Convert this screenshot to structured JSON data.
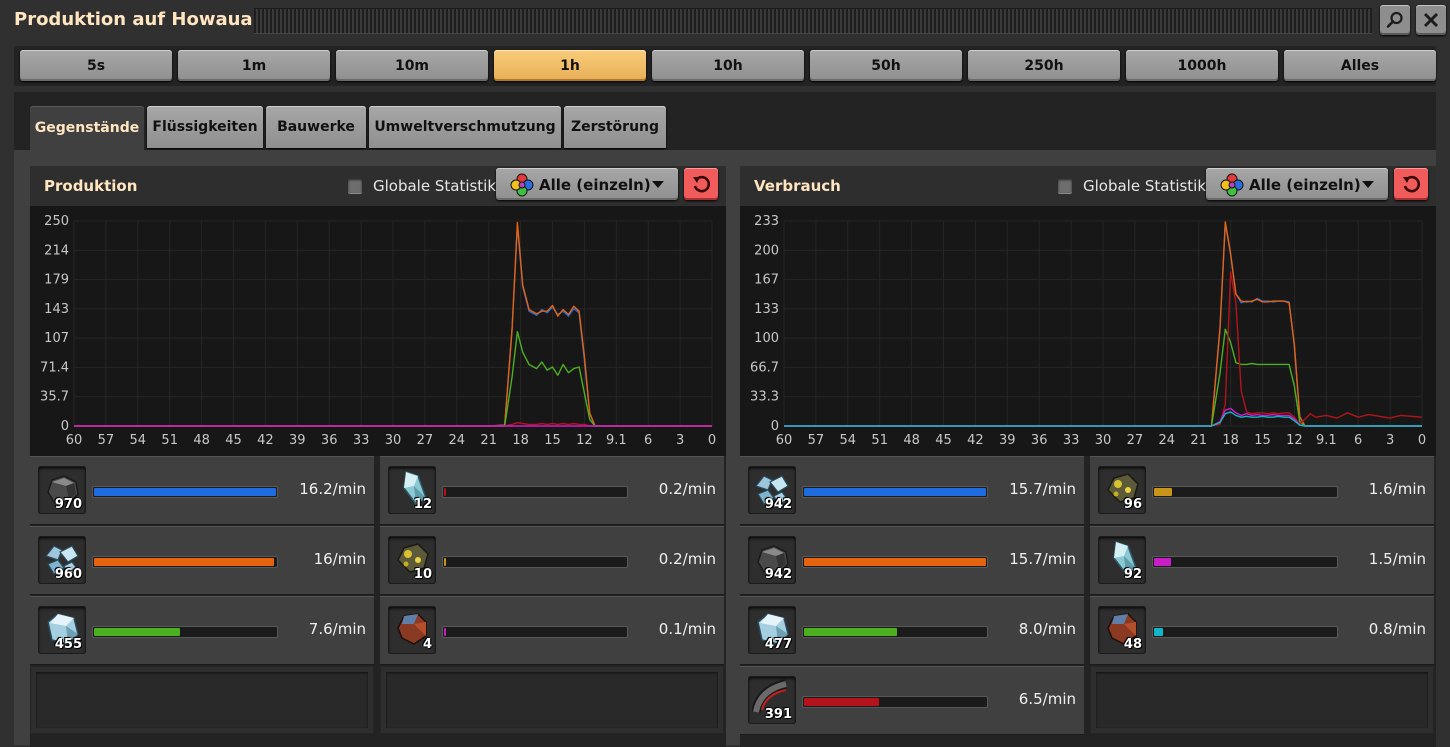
{
  "window": {
    "title": "Produktion auf Howaua"
  },
  "time_buttons": [
    {
      "label": "5s",
      "active": false
    },
    {
      "label": "1m",
      "active": false
    },
    {
      "label": "10m",
      "active": false
    },
    {
      "label": "1h",
      "active": true
    },
    {
      "label": "10h",
      "active": false
    },
    {
      "label": "50h",
      "active": false
    },
    {
      "label": "250h",
      "active": false
    },
    {
      "label": "1000h",
      "active": false
    },
    {
      "label": "Alles",
      "active": false
    }
  ],
  "tabs": [
    {
      "label": "Gegenstände",
      "active": true
    },
    {
      "label": "Flüssigkeiten",
      "active": false
    },
    {
      "label": "Bauwerke",
      "active": false
    },
    {
      "label": "Umweltverschmutzung",
      "active": false
    },
    {
      "label": "Zerstörung",
      "active": false
    }
  ],
  "colors": {
    "blue": "#1f6ce0",
    "orange": "#e5620f",
    "green": "#4caf1f",
    "red": "#b3141b",
    "yellow": "#c8951a",
    "magenta": "#c81ec8",
    "cyan": "#13b5c8"
  },
  "panels": [
    {
      "title": "Produktion",
      "global_label": "Globale Statistik",
      "dropdown_label": "Alle (einzeln)",
      "rows": [
        {
          "icon": "stone-icon",
          "count": "970",
          "rate": "16.2/min",
          "fill": 1.0,
          "color": "#1f6ce0"
        },
        {
          "icon": "ice-icon",
          "count": "12",
          "rate": "0.2/min",
          "fill": 0.012,
          "color": "#b3141b"
        },
        {
          "icon": "calcite-icon",
          "count": "960",
          "rate": "16/min",
          "fill": 0.99,
          "color": "#e5620f"
        },
        {
          "icon": "sulfur-ore-icon",
          "count": "10",
          "rate": "0.2/min",
          "fill": 0.01,
          "color": "#c8951a"
        },
        {
          "icon": "crystal-ore-icon",
          "count": "455",
          "rate": "7.6/min",
          "fill": 0.47,
          "color": "#4caf1f"
        },
        {
          "icon": "iron-ore-icon",
          "count": "4",
          "rate": "0.1/min",
          "fill": 0.005,
          "color": "#c81ec8"
        }
      ]
    },
    {
      "title": "Verbrauch",
      "global_label": "Globale Statistik",
      "dropdown_label": "Alle (einzeln)",
      "rows": [
        {
          "icon": "calcite-icon",
          "count": "942",
          "rate": "15.7/min",
          "fill": 1.0,
          "color": "#1f6ce0"
        },
        {
          "icon": "sulfur-ore-icon",
          "count": "96",
          "rate": "1.6/min",
          "fill": 0.1,
          "color": "#c8951a"
        },
        {
          "icon": "stone-icon",
          "count": "942",
          "rate": "15.7/min",
          "fill": 1.0,
          "color": "#e5620f"
        },
        {
          "icon": "ice-icon",
          "count": "92",
          "rate": "1.5/min",
          "fill": 0.096,
          "color": "#c81ec8"
        },
        {
          "icon": "crystal-ore-icon",
          "count": "477",
          "rate": "8.0/min",
          "fill": 0.51,
          "color": "#4caf1f"
        },
        {
          "icon": "iron-ore-icon",
          "count": "48",
          "rate": "0.8/min",
          "fill": 0.05,
          "color": "#13b5c8"
        },
        {
          "icon": "rail-icon",
          "count": "391",
          "rate": "6.5/min",
          "fill": 0.41,
          "color": "#b3141b"
        }
      ]
    }
  ],
  "chart_data": [
    {
      "type": "line",
      "title": "Produktion",
      "x_ticks": [
        "60",
        "57",
        "54",
        "51",
        "48",
        "45",
        "42",
        "39",
        "36",
        "33",
        "30",
        "27",
        "24",
        "21",
        "18",
        "15",
        "12",
        "9.1",
        "6",
        "3",
        "0"
      ],
      "y_ticks": [
        "0",
        "35.7",
        "71.4",
        "107",
        "143",
        "179",
        "214",
        "250"
      ],
      "ylim": [
        0,
        250
      ],
      "x": [
        60,
        21,
        19.5,
        18.8,
        18.3,
        17.8,
        17.2,
        16.5,
        16,
        15.5,
        15,
        14.5,
        14,
        13.5,
        13,
        12.5,
        12,
        11.5,
        11,
        10.5,
        10,
        9.5,
        0
      ],
      "series": [
        {
          "color": "#1f6ce0",
          "values": [
            0,
            0,
            1,
            120,
            245,
            170,
            140,
            135,
            142,
            138,
            145,
            136,
            140,
            134,
            143,
            138,
            80,
            15,
            0,
            0,
            0,
            0,
            0
          ]
        },
        {
          "color": "#e5620f",
          "values": [
            0,
            0,
            1,
            118,
            248,
            172,
            142,
            137,
            140,
            140,
            147,
            134,
            142,
            136,
            146,
            140,
            85,
            16,
            0,
            0,
            0,
            0,
            0
          ]
        },
        {
          "color": "#4caf1f",
          "values": [
            0,
            0,
            0,
            60,
            115,
            90,
            75,
            70,
            78,
            68,
            72,
            62,
            75,
            65,
            70,
            72,
            40,
            8,
            0,
            0,
            0,
            0,
            0
          ]
        },
        {
          "color": "#b3141b",
          "values": [
            0,
            0,
            0,
            2,
            4,
            3,
            2,
            2,
            3,
            2,
            3,
            2,
            3,
            2,
            3,
            2,
            2,
            0,
            0,
            0,
            0,
            0,
            0
          ]
        },
        {
          "color": "#c81ec8",
          "values": [
            0,
            0,
            0,
            0,
            0,
            0,
            0,
            0,
            0,
            0,
            0,
            0,
            0,
            0,
            0,
            0,
            0,
            0,
            0,
            0,
            0,
            0,
            0
          ]
        }
      ]
    },
    {
      "type": "line",
      "title": "Verbrauch",
      "x_ticks": [
        "60",
        "57",
        "54",
        "51",
        "48",
        "45",
        "42",
        "39",
        "36",
        "33",
        "30",
        "27",
        "24",
        "21",
        "18",
        "15",
        "12",
        "9.1",
        "6",
        "3",
        "0"
      ],
      "y_ticks": [
        "0",
        "33.3",
        "66.7",
        "100",
        "133",
        "167",
        "200",
        "233"
      ],
      "ylim": [
        0,
        233
      ],
      "x": [
        60,
        21,
        19.8,
        19,
        18.5,
        18,
        17.5,
        17,
        16.5,
        16,
        15.5,
        15,
        14.5,
        14,
        13.5,
        13,
        12.5,
        12,
        11.5,
        11,
        10.5,
        10,
        9,
        8,
        7,
        6,
        5,
        4,
        3,
        2,
        1,
        0
      ],
      "series": [
        {
          "color": "#1f6ce0",
          "values": [
            0,
            0,
            0,
            110,
            230,
            195,
            150,
            140,
            142,
            141,
            145,
            142,
            142,
            141,
            142,
            142,
            141,
            90,
            10,
            0,
            0,
            0,
            0,
            0,
            0,
            0,
            0,
            0,
            0,
            0,
            0,
            0
          ]
        },
        {
          "color": "#e5620f",
          "values": [
            0,
            0,
            0,
            112,
            232,
            196,
            150,
            142,
            141,
            142,
            144,
            141,
            141,
            142,
            142,
            142,
            140,
            92,
            11,
            0,
            0,
            0,
            0,
            0,
            0,
            0,
            0,
            0,
            0,
            0,
            0,
            0
          ]
        },
        {
          "color": "#4caf1f",
          "values": [
            0,
            0,
            0,
            60,
            110,
            95,
            72,
            70,
            70,
            71,
            70,
            70,
            70,
            70,
            70,
            70,
            70,
            45,
            5,
            0,
            0,
            0,
            0,
            0,
            0,
            0,
            0,
            0,
            0,
            0,
            0,
            0
          ]
        },
        {
          "color": "#b3141b",
          "values": [
            0,
            0,
            0,
            2,
            25,
            175,
            140,
            40,
            16,
            14,
            15,
            15,
            14,
            15,
            14,
            15,
            15,
            10,
            2,
            8,
            14,
            10,
            12,
            9,
            15,
            10,
            13,
            11,
            9,
            12,
            11,
            10
          ]
        },
        {
          "color": "#c81ec8",
          "values": [
            0,
            0,
            0,
            5,
            18,
            20,
            15,
            12,
            14,
            12,
            13,
            12,
            12,
            13,
            12,
            12,
            12,
            8,
            1,
            0,
            0,
            0,
            0,
            0,
            0,
            0,
            0,
            0,
            0,
            0,
            0,
            0
          ]
        },
        {
          "color": "#13b5c8",
          "values": [
            0,
            0,
            0,
            4,
            14,
            16,
            12,
            10,
            11,
            10,
            10,
            11,
            10,
            10,
            11,
            10,
            10,
            6,
            1,
            0,
            0,
            0,
            0,
            0,
            0,
            0,
            0,
            0,
            0,
            0,
            0,
            0
          ]
        }
      ]
    }
  ]
}
